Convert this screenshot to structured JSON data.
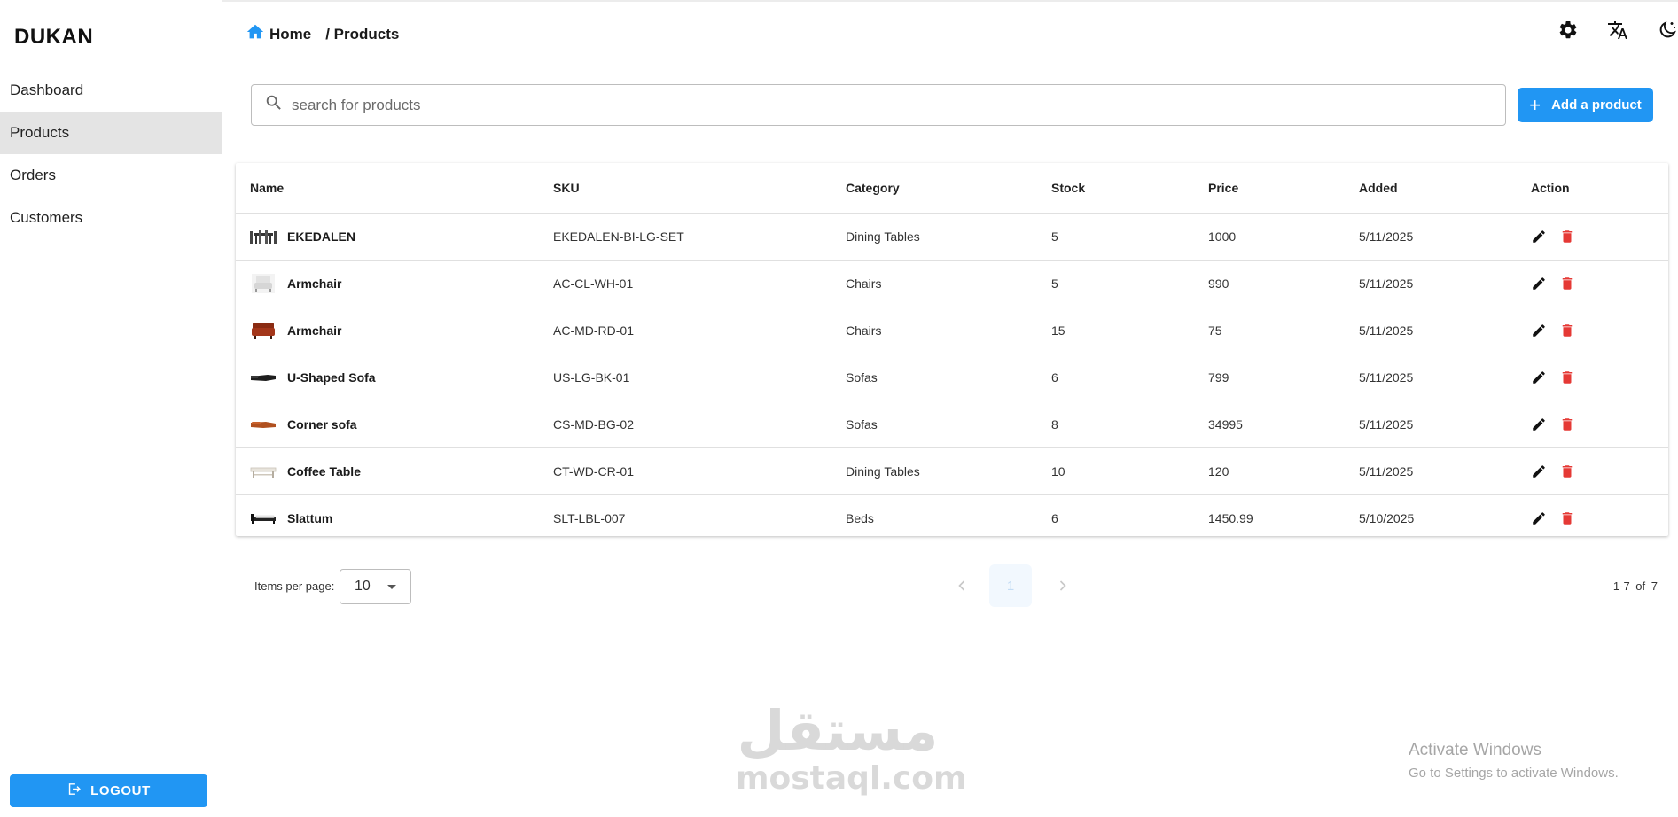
{
  "sidebar": {
    "brand": "DUKAN",
    "items": [
      {
        "label": "Dashboard"
      },
      {
        "label": "Products"
      },
      {
        "label": "Orders"
      },
      {
        "label": "Customers"
      }
    ],
    "active_item": "Products",
    "logout_label": "LOGOUT"
  },
  "header": {
    "breadcrumb_home": "Home",
    "breadcrumb_current": "/ Products",
    "icons": [
      "gear-icon",
      "translate-icon",
      "dark-mode-icon"
    ]
  },
  "search": {
    "placeholder": "search for products",
    "value": ""
  },
  "add_button": {
    "label": "Add a product"
  },
  "table": {
    "columns": [
      "Name",
      "SKU",
      "Category",
      "Stock",
      "Price",
      "Added",
      "Action"
    ],
    "rows": [
      {
        "name": "EKEDALEN",
        "sku": "EKEDALEN-BI-LG-SET",
        "category": "Dining Tables",
        "stock": "5",
        "price": "1000",
        "added": "5/11/2025",
        "thumb": "dining-set"
      },
      {
        "name": "Armchair",
        "sku": "AC-CL-WH-01",
        "category": "Chairs",
        "stock": "5",
        "price": "990",
        "added": "5/11/2025",
        "thumb": "white-armchair"
      },
      {
        "name": "Armchair",
        "sku": "AC-MD-RD-01",
        "category": "Chairs",
        "stock": "15",
        "price": "75",
        "added": "5/11/2025",
        "thumb": "red-armchair"
      },
      {
        "name": "U-Shaped Sofa",
        "sku": "US-LG-BK-01",
        "category": "Sofas",
        "stock": "6",
        "price": "799",
        "added": "5/11/2025",
        "thumb": "black-sofa"
      },
      {
        "name": "Corner sofa",
        "sku": "CS-MD-BG-02",
        "category": "Sofas",
        "stock": "8",
        "price": "34995",
        "added": "5/11/2025",
        "thumb": "brown-sofa"
      },
      {
        "name": "Coffee Table",
        "sku": "CT-WD-CR-01",
        "category": "Dining Tables",
        "stock": "10",
        "price": "120",
        "added": "5/11/2025",
        "thumb": "coffee-table"
      },
      {
        "name": "Slattum",
        "sku": "SLT-LBL-007",
        "category": "Beds",
        "stock": "6",
        "price": "1450.99",
        "added": "5/10/2025",
        "thumb": "bed"
      }
    ],
    "action_icons": [
      "edit-icon",
      "delete-icon"
    ]
  },
  "pagination": {
    "items_per_page_label": "Items per page:",
    "items_per_page_value": "10",
    "current_page": "1",
    "range_text": "1-7  of  7"
  },
  "watermark": {
    "arabic": "مستقل",
    "latin": "mostaql.com"
  },
  "os_overlay": {
    "line1": "Activate Windows",
    "line2": "Go to Settings to activate Windows."
  },
  "colors": {
    "primary": "#2196f3",
    "delete": "#e53935",
    "active_nav_bg": "#e4e4e4"
  }
}
